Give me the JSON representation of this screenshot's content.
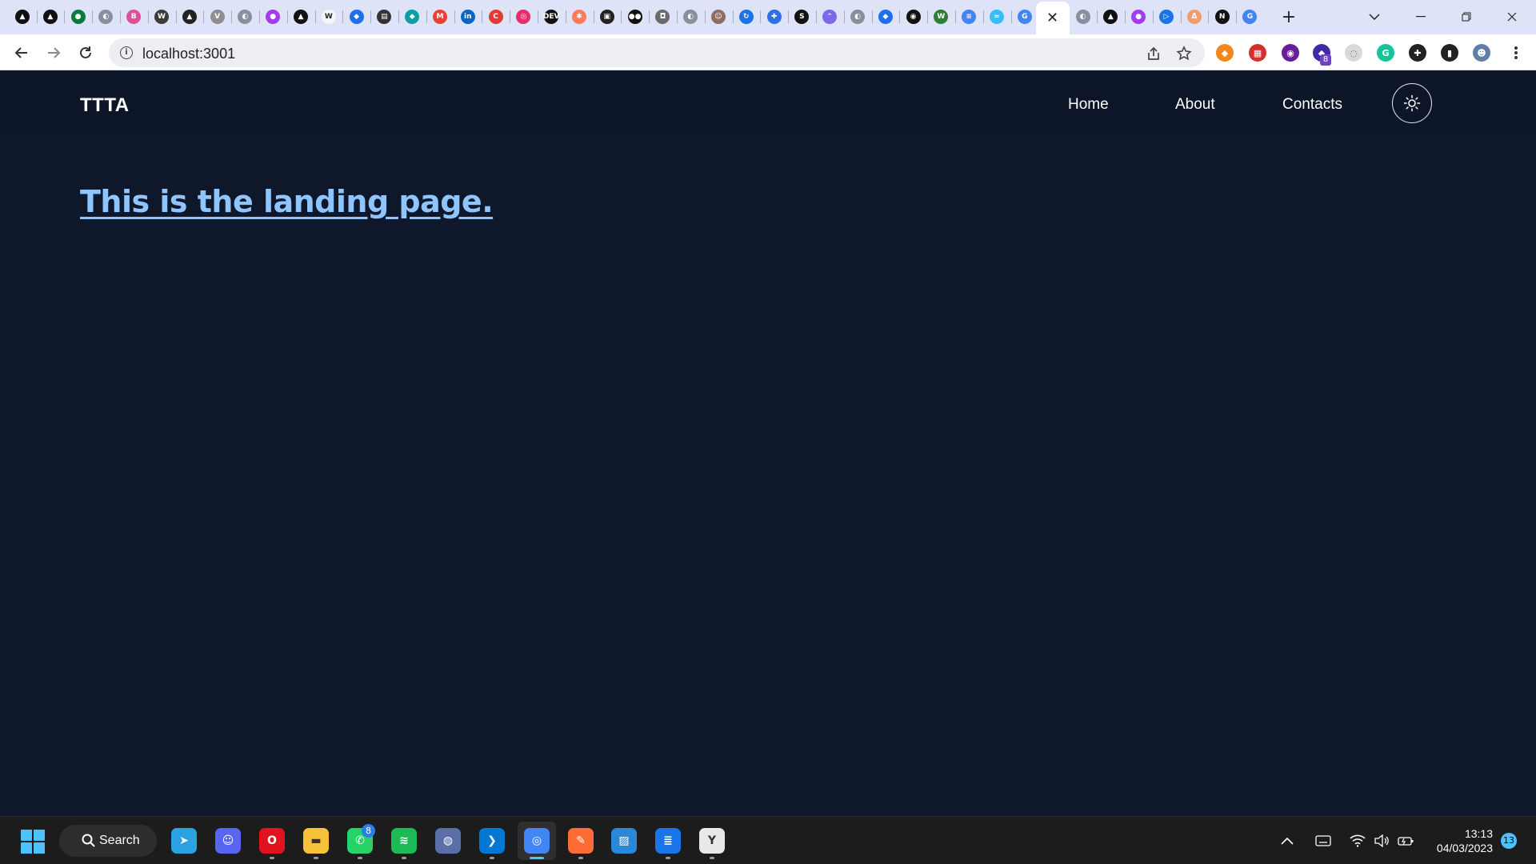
{
  "browser": {
    "tabs": [
      {
        "icon": "a-black-icon",
        "color": "#111111",
        "glyph": "▲"
      },
      {
        "icon": "a-black-icon",
        "color": "#111111",
        "glyph": "▲"
      },
      {
        "icon": "leaf-green-icon",
        "color": "#0a7a3e",
        "glyph": "●"
      },
      {
        "icon": "globe-icon",
        "color": "#8a8f9e",
        "glyph": "◐"
      },
      {
        "icon": "gradient-b-icon",
        "color": "#e0509a",
        "glyph": "B"
      },
      {
        "icon": "w-box-icon",
        "color": "#3c3c3c",
        "glyph": "W"
      },
      {
        "icon": "pyramid-icon",
        "color": "#222222",
        "glyph": "▲"
      },
      {
        "icon": "v-icon",
        "color": "#8f8f8f",
        "glyph": "V"
      },
      {
        "icon": "globe-icon",
        "color": "#8a8f9e",
        "glyph": "◐"
      },
      {
        "icon": "messenger-icon",
        "color": "#a23cf0",
        "glyph": "●"
      },
      {
        "icon": "flask-icon",
        "color": "#111111",
        "glyph": "▲"
      },
      {
        "icon": "wiki-icon",
        "color": "#f5f5f5",
        "glyph": "W"
      },
      {
        "icon": "blue-diamond-icon",
        "color": "#1f6feb",
        "glyph": "◆"
      },
      {
        "icon": "ledger-icon",
        "color": "#333333",
        "glyph": "▤"
      },
      {
        "icon": "teal-diamond-icon",
        "color": "#0c9ea4",
        "glyph": "◆"
      },
      {
        "icon": "gmail-icon",
        "color": "#e94235",
        "glyph": "M"
      },
      {
        "icon": "linkedin-icon",
        "color": "#0a66c2",
        "glyph": "in"
      },
      {
        "icon": "c-red-icon",
        "color": "#e53935",
        "glyph": "C"
      },
      {
        "icon": "instagram-icon",
        "color": "#e1306c",
        "glyph": "◎"
      },
      {
        "icon": "dev-icon",
        "color": "#111111",
        "glyph": "DEV"
      },
      {
        "icon": "hubspot-icon",
        "color": "#ff7a59",
        "glyph": "✱"
      },
      {
        "icon": "box-icon",
        "color": "#222222",
        "glyph": "▣"
      },
      {
        "icon": "medium-icon",
        "color": "#111111",
        "glyph": "●●"
      },
      {
        "icon": "shield-icon",
        "color": "#6b6b6b",
        "glyph": "◘"
      },
      {
        "icon": "globe-icon",
        "color": "#8a8f9e",
        "glyph": "◐"
      },
      {
        "icon": "avatar-icon",
        "color": "#8d6e63",
        "glyph": "☺"
      },
      {
        "icon": "blue-swirl-icon",
        "color": "#1a73e8",
        "glyph": "↻"
      },
      {
        "icon": "puzzle-icon",
        "color": "#2f6fe0",
        "glyph": "✚"
      },
      {
        "icon": "s-black-icon",
        "color": "#111111",
        "glyph": "S"
      },
      {
        "icon": "clickup-icon",
        "color": "#7b68ee",
        "glyph": "⌃"
      },
      {
        "icon": "globe-icon",
        "color": "#8a8f9e",
        "glyph": "◐"
      },
      {
        "icon": "blue-diamond-icon",
        "color": "#1f6feb",
        "glyph": "◆"
      },
      {
        "icon": "github-icon",
        "color": "#111111",
        "glyph": "◉"
      },
      {
        "icon": "w-green-icon",
        "color": "#2e7d32",
        "glyph": "W"
      },
      {
        "icon": "docs-icon",
        "color": "#4285f4",
        "glyph": "≡"
      },
      {
        "icon": "tailwind-icon",
        "color": "#38bdf8",
        "glyph": "≈"
      },
      {
        "icon": "google-icon",
        "color": "#4285f4",
        "glyph": "G"
      },
      {
        "icon": "active-tab-close-icon",
        "color": "#ffffff",
        "glyph": "✕",
        "active": true
      },
      {
        "icon": "globe-icon",
        "color": "#8a8f9e",
        "glyph": "◐"
      },
      {
        "icon": "a-black-icon",
        "color": "#111111",
        "glyph": "▲"
      },
      {
        "icon": "messenger-icon",
        "color": "#a23cf0",
        "glyph": "●"
      },
      {
        "icon": "play-icon",
        "color": "#1a73e8",
        "glyph": "▷"
      },
      {
        "icon": "flame-icon",
        "color": "#f49b6b",
        "glyph": "ᐃ"
      },
      {
        "icon": "notion-n-icon",
        "color": "#111111",
        "glyph": "N"
      },
      {
        "icon": "google-icon",
        "color": "#4285f4",
        "glyph": "G"
      }
    ],
    "new_tab": "+",
    "url": "localhost:3001",
    "extensions": [
      {
        "icon": "metamask-icon",
        "color": "#f6851b",
        "glyph": "◆"
      },
      {
        "icon": "red-ext-icon",
        "color": "#d32f2f",
        "glyph": "▦"
      },
      {
        "icon": "color-ring-icon",
        "color": "#6a1b9a",
        "glyph": "◉"
      },
      {
        "icon": "cap-icon",
        "color": "#3f2aa8",
        "glyph": "◆"
      },
      {
        "icon": "timer-icon",
        "color": "#d9d9d9",
        "glyph": "◌"
      },
      {
        "icon": "grammarly-icon",
        "color": "#15c39a",
        "glyph": "G"
      },
      {
        "icon": "puzzle-ext-icon",
        "color": "#222222",
        "glyph": "✚"
      },
      {
        "icon": "sidepanel-icon",
        "color": "#222222",
        "glyph": "▮"
      },
      {
        "icon": "profile-avatar-icon",
        "color": "#5d7fa8",
        "glyph": "☻"
      }
    ],
    "ext_badge": "8"
  },
  "site": {
    "logo": "TTTA",
    "nav": [
      "Home",
      "About",
      "Contacts"
    ],
    "headline": "This is the landing page.",
    "colors": {
      "background": "#0f172a",
      "header": "#0c1628",
      "link": "#8ec5ff"
    }
  },
  "taskbar": {
    "search_label": "Search",
    "apps": [
      {
        "icon": "telegram-icon",
        "color": "#2aa3e0",
        "glyph": "➤"
      },
      {
        "icon": "discord-icon",
        "color": "#5865f2",
        "glyph": "☺"
      },
      {
        "icon": "opera-icon",
        "color": "#e0131e",
        "glyph": "O"
      },
      {
        "icon": "file-explorer-icon",
        "color": "#f5c23a",
        "glyph": "▬"
      },
      {
        "icon": "whatsapp-icon",
        "color": "#25d366",
        "glyph": "✆"
      },
      {
        "icon": "spotify-icon",
        "color": "#1db954",
        "glyph": "≋"
      },
      {
        "icon": "globe-app-icon",
        "color": "#5a6fa8",
        "glyph": "◍"
      },
      {
        "icon": "vscode-icon",
        "color": "#0078d4",
        "glyph": "❯"
      },
      {
        "icon": "chrome-icon",
        "color": "#4285f4",
        "glyph": "◎"
      },
      {
        "icon": "postman-icon",
        "color": "#ff6c37",
        "glyph": "✎"
      },
      {
        "icon": "remote-desktop-icon",
        "color": "#2b88d8",
        "glyph": "▨"
      },
      {
        "icon": "docs-app-icon",
        "color": "#1a73e8",
        "glyph": "≣"
      },
      {
        "icon": "clock-app-icon",
        "color": "#e8e8e8",
        "glyph": "Y"
      }
    ],
    "whatsapp_badge": "8",
    "time": "13:13",
    "date": "04/03/2023",
    "notifications": "13"
  }
}
